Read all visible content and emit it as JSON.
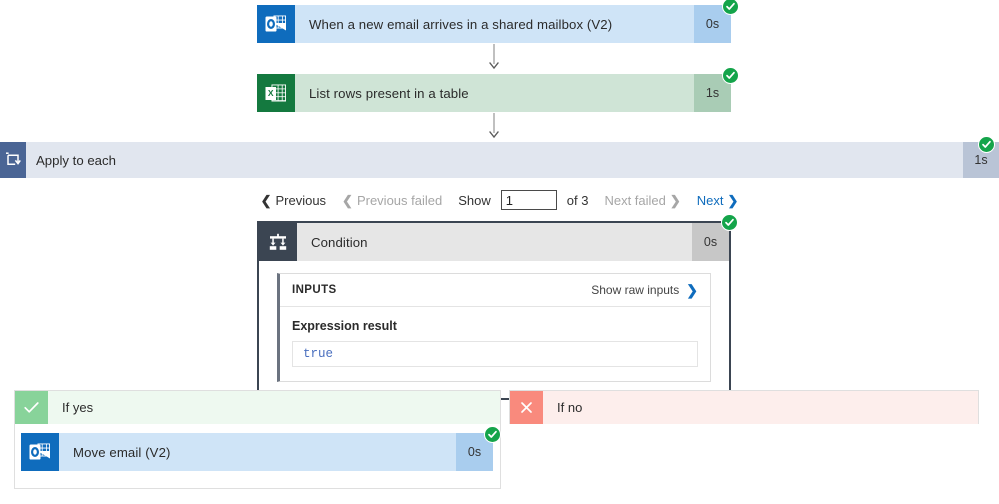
{
  "flow": {
    "steps": [
      {
        "name": "trigger",
        "title": "When a new email arrives in a shared mailbox (V2)",
        "duration": "0s",
        "status": "succeeded",
        "icon": "outlook-icon",
        "accent": "#0f6cbd"
      },
      {
        "name": "list-rows",
        "title": "List rows present in a table",
        "duration": "1s",
        "status": "succeeded",
        "icon": "excel-icon",
        "accent": "#14793f"
      }
    ],
    "scope": {
      "title": "Apply to each",
      "duration": "1s",
      "status": "succeeded",
      "icon": "foreach-loop-icon",
      "accent": "#4a6595"
    },
    "pagination": {
      "previous": "Previous",
      "previous_failed": "Previous failed",
      "show_label": "Show",
      "page_value": "1",
      "of_label": "of 3",
      "next_failed": "Next failed",
      "next": "Next",
      "chevron_left": "❮",
      "chevron_right": "❯"
    },
    "condition": {
      "title": "Condition",
      "duration": "0s",
      "status": "succeeded",
      "icon": "condition-branch-icon",
      "inputs": {
        "header": "INPUTS",
        "show_raw": "Show raw inputs",
        "show_raw_chevron": "❯",
        "expression_label": "Expression result",
        "expression_value": "true"
      }
    },
    "branches": [
      {
        "name": "if-yes",
        "title": "If yes",
        "icon": "checkmark-icon",
        "accent": "#88d39a",
        "action": {
          "title": "Move email (V2)",
          "duration": "0s",
          "status": "succeeded",
          "icon": "outlook-icon",
          "accent": "#0f6cbd"
        }
      },
      {
        "name": "if-no",
        "title": "If no",
        "icon": "close-x-icon",
        "accent": "#f98a7d",
        "action": null
      }
    ],
    "colors": {
      "success_green": "#14a44a",
      "link_blue": "#0f6cbd",
      "outlook_blue": "#0f6cbd",
      "excel_green": "#14793f",
      "condition_grey": "#3b4552"
    }
  }
}
